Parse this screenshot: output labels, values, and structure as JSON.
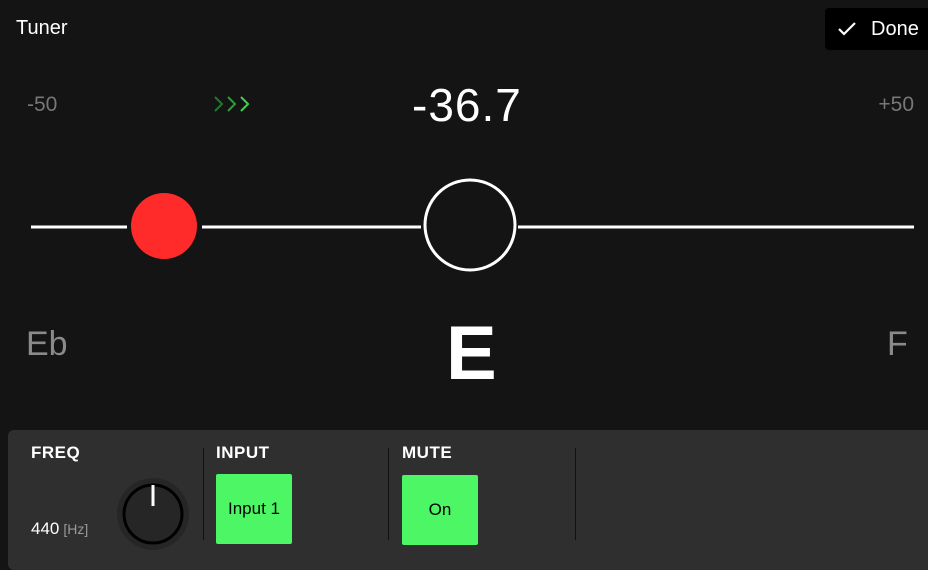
{
  "header": {
    "title": "Tuner",
    "done_label": "Done"
  },
  "scale": {
    "min_label": "-50",
    "max_label": "+50",
    "cents_display": "-36.7",
    "cents_value": -36.7
  },
  "notes": {
    "lower": "Eb",
    "current": "E",
    "upper": "F"
  },
  "colors": {
    "indicator": "#ff2a2a",
    "arrows": "#2fbf3f",
    "button_on": "#4cf664"
  },
  "controls": {
    "freq": {
      "label": "FREQ",
      "value": "440",
      "unit": "[Hz]"
    },
    "input": {
      "label": "INPUT",
      "value": "Input 1"
    },
    "mute": {
      "label": "MUTE",
      "value": "On"
    }
  }
}
